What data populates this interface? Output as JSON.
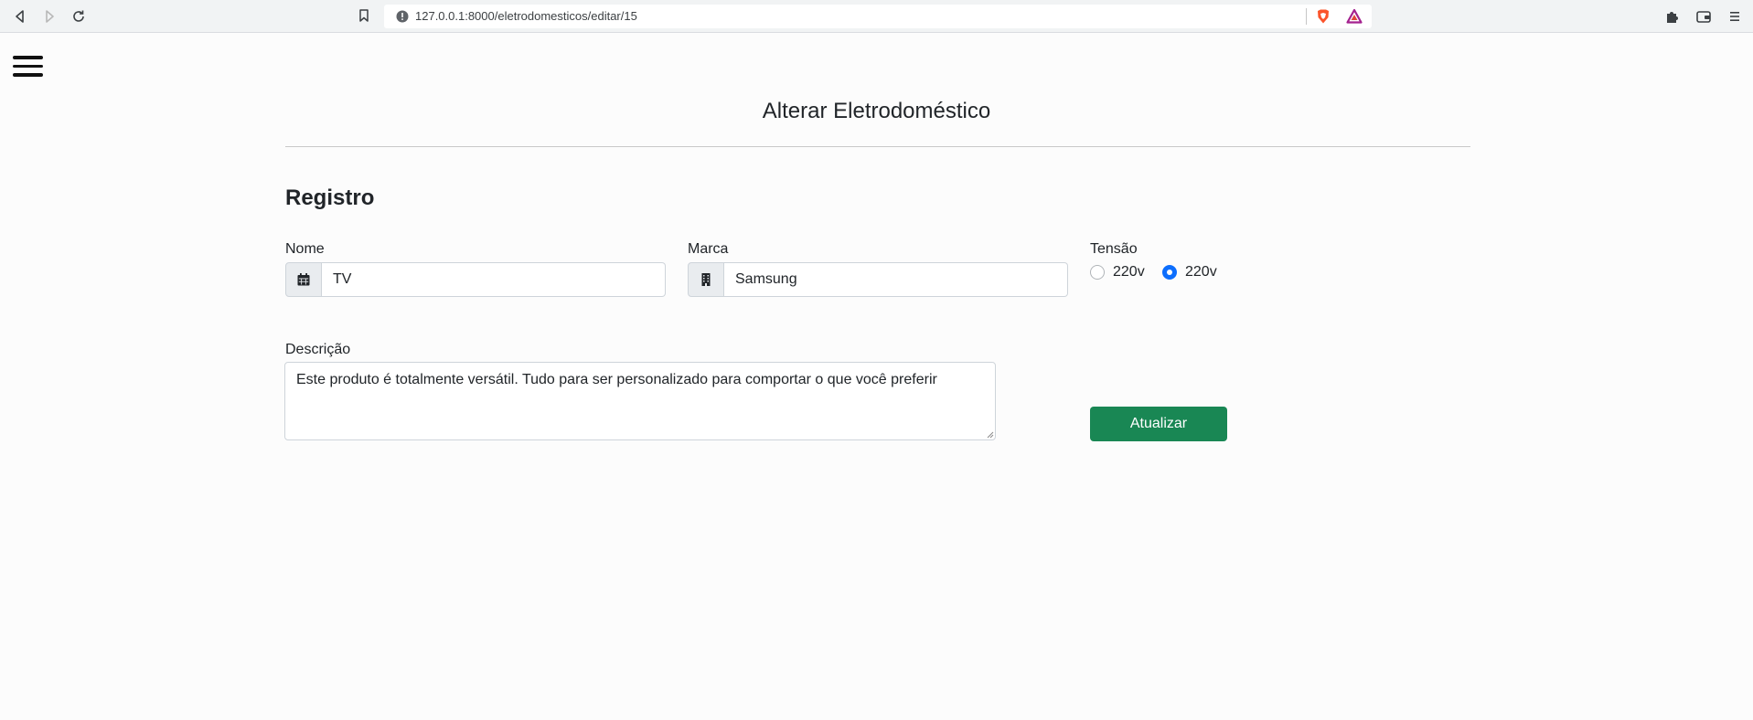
{
  "browser": {
    "url": "127.0.0.1:8000/eletrodomesticos/editar/15"
  },
  "page": {
    "title": "Alterar Eletrodoméstico",
    "section_title": "Registro"
  },
  "form": {
    "nome_label": "Nome",
    "nome_value": "TV",
    "marca_label": "Marca",
    "marca_value": "Samsung",
    "tensao_label": "Tensão",
    "tensao_options": [
      {
        "label": "220v",
        "checked": false
      },
      {
        "label": "220v",
        "checked": true
      }
    ],
    "descricao_label": "Descrição",
    "descricao_value": "Este produto é totalmente versátil. Tudo para ser personalizado para comportar o que você preferir",
    "submit_label": "Atualizar"
  },
  "colors": {
    "primary": "#0d6efd",
    "success": "#198754"
  }
}
